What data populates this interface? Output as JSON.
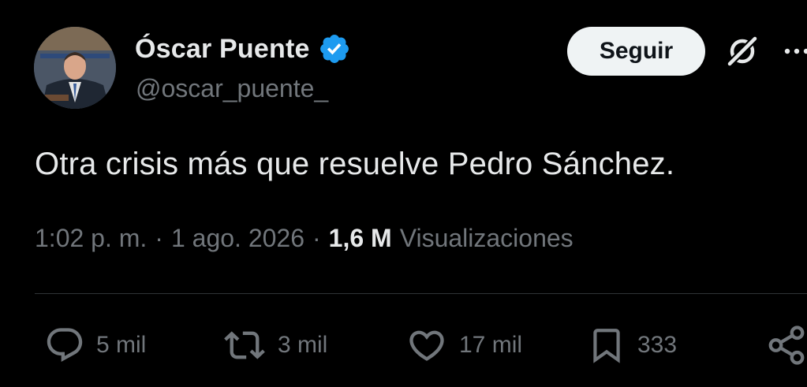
{
  "author": {
    "display_name": "Óscar Puente",
    "handle": "@oscar_puente_",
    "verified": true,
    "verified_color": "#1d9bf0"
  },
  "header": {
    "follow_label": "Seguir",
    "grok_icon": "grok-icon",
    "more_icon": "more-icon"
  },
  "tweet": {
    "text": "Otra crisis más que resuelve Pedro Sánchez."
  },
  "meta": {
    "time": "1:02 p. m.",
    "date": "1 ago. 2026",
    "separator": "·",
    "views_count": "1,6 M",
    "views_label": "Visualizaciones"
  },
  "actions": {
    "replies": "5 mil",
    "reposts": "3 mil",
    "likes": "17 mil",
    "bookmarks": "333"
  },
  "colors": {
    "background": "#000000",
    "text_primary": "#e7e9ea",
    "text_secondary": "#71767b",
    "divider": "#2f3336",
    "follow_bg": "#eff3f4"
  }
}
